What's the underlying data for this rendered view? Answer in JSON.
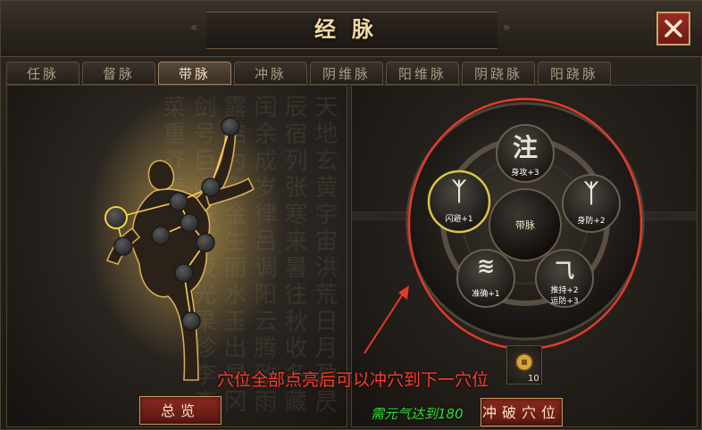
{
  "window": {
    "title": "经脉"
  },
  "tabs": [
    {
      "label": "任脉",
      "active": false
    },
    {
      "label": "督脉",
      "active": false
    },
    {
      "label": "带脉",
      "active": true
    },
    {
      "label": "冲脉",
      "active": false
    },
    {
      "label": "阴维脉",
      "active": false
    },
    {
      "label": "阳维脉",
      "active": false
    },
    {
      "label": "阴跷脉",
      "active": false
    },
    {
      "label": "阳跷脉",
      "active": false
    }
  ],
  "left_panel": {
    "overview_button": "总览",
    "calligraphy_text": "天地玄黄宇宙洪荒日月盈昃辰宿列张寒来暑往秋收冬藏闰余成岁律吕调阳云腾致雨露结为霜金生丽水玉出昆冈剑号巨阙珠称夜光果珍李柰菜重芥姜"
  },
  "wheel": {
    "center_label": "带脉",
    "nodes": [
      {
        "glyph": "注",
        "stat": "身攻+3"
      },
      {
        "glyph": "ᛉ",
        "stat": "身防+2"
      },
      {
        "glyph": "⺄",
        "stat": "推持+2",
        "stat2": "运防+3"
      },
      {
        "glyph": "≋",
        "stat": "准确+1"
      },
      {
        "glyph": "ᛉ",
        "stat": "闪避+1",
        "selected": true
      }
    ]
  },
  "item": {
    "count": "10",
    "icon": "coin-icon"
  },
  "hint_text": "穴位全部点亮后可以冲穴到下一穴位",
  "requirement_text": "需元气达到180",
  "breakthrough_button": "冲破穴位",
  "colors": {
    "accent_gold": "#d9b36a",
    "hint_red": "#ff3b2b",
    "requirement_green": "#34e334",
    "button_red": "#8c2a22"
  }
}
